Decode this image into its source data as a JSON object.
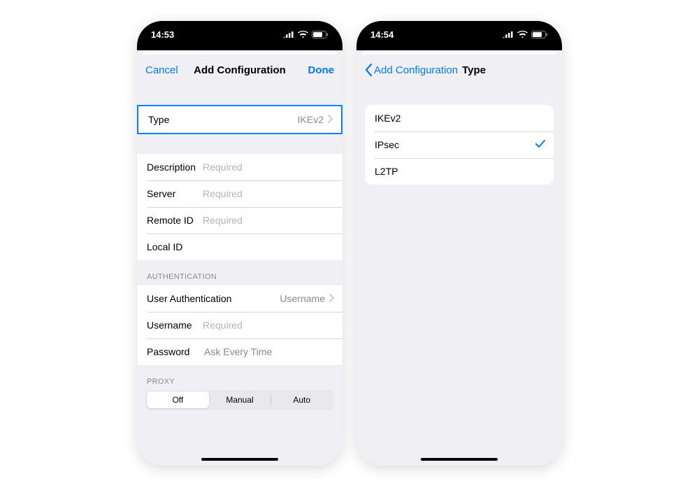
{
  "status": {
    "time_left": "14:53",
    "time_right": "14:54"
  },
  "left": {
    "nav": {
      "cancel": "Cancel",
      "title": "Add Configuration",
      "done": "Done"
    },
    "type_row": {
      "label": "Type",
      "value": "IKEv2"
    },
    "fields": {
      "description_label": "Description",
      "description_placeholder": "Required",
      "server_label": "Server",
      "server_placeholder": "Required",
      "remoteid_label": "Remote ID",
      "remoteid_placeholder": "Required",
      "localid_label": "Local ID"
    },
    "auth": {
      "header": "Authentication",
      "user_auth_label": "User Authentication",
      "user_auth_value": "Username",
      "username_label": "Username",
      "username_placeholder": "Required",
      "password_label": "Password",
      "password_value": "Ask Every Time"
    },
    "proxy": {
      "header": "Proxy",
      "segments": {
        "off": "Off",
        "manual": "Manual",
        "auto": "Auto"
      },
      "selected": "Off"
    }
  },
  "right": {
    "nav": {
      "back": "Add Configuration",
      "title": "Type"
    },
    "options": {
      "ikev2": "IKEv2",
      "ipsec": "IPsec",
      "l2tp": "L2TP",
      "selected": "IPsec"
    }
  }
}
